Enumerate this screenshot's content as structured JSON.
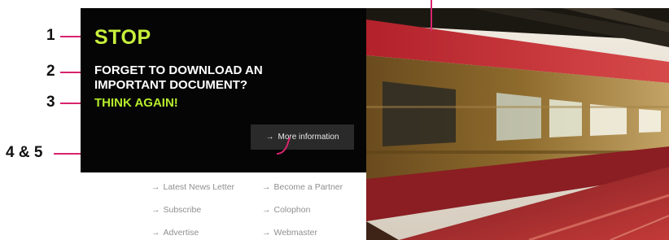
{
  "callouts": {
    "c1": "1",
    "c2": "2",
    "c3": "3",
    "c45": "4 & 5"
  },
  "hero": {
    "title": "STOP",
    "question_line1": "FORGET TO DOWNLOAD AN",
    "question_line2": "IMPORTANT DOCUMENT?",
    "think": "THINK AGAIN!",
    "more_button": "More information",
    "arrow": "→"
  },
  "footer_links": [
    {
      "label": "Latest News Letter"
    },
    {
      "label": "Become a Partner"
    },
    {
      "label": "Subscribe"
    },
    {
      "label": "Colophon"
    },
    {
      "label": "Advertise"
    },
    {
      "label": "Webmaster"
    }
  ],
  "photo": {
    "subject": "blurred red and yellow train at station platform"
  },
  "colors": {
    "callout_line": "#d8246e",
    "accent_green": "#c8f03c",
    "panel_bg": "#050505"
  }
}
